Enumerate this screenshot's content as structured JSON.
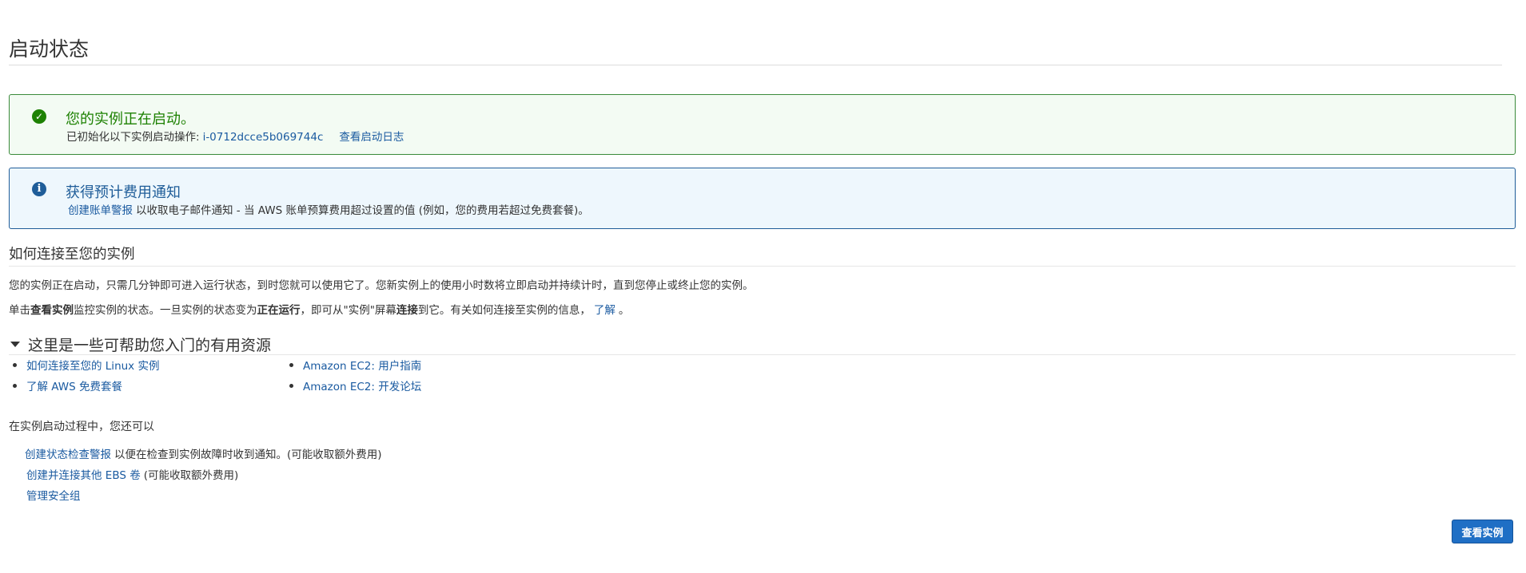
{
  "page": {
    "title": "启动状态"
  },
  "success_alert": {
    "title": "您的实例正在启动。",
    "body_prefix": "已初始化以下实例启动操作:",
    "instance_id": "i-0712dcce5b069744c",
    "view_log_link": "查看启动日志",
    "icon": "check-circle-icon",
    "color": "#1d8102"
  },
  "info_alert": {
    "title": "获得预计费用通知",
    "link": "创建账单警报",
    "body": "以收取电子邮件通知 - 当 AWS 账单预算费用超过设置的值 (例如，您的费用若超过免费套餐)。",
    "icon": "info-circle-icon",
    "color": "#1f5d99"
  },
  "connect_section": {
    "heading": "如何连接至您的实例",
    "paragraph1": "您的实例正在启动，只需几分钟即可进入运行状态，到时您就可以使用它了。您新实例上的使用小时数将立即启动并持续计时，直到您停止或终止您的实例。",
    "p2_a": "单击",
    "p2_b": "查看实例",
    "p2_c": "监控实例的状态。一旦实例的状态变为",
    "p2_d": "正在运行",
    "p2_e": "，即可从\"实例\"屏幕",
    "p2_f": "连接",
    "p2_g": "到它。有关如何连接至实例的信息，",
    "p2_link": "了解",
    "p2_end": "。"
  },
  "resources": {
    "heading": "这里是一些可帮助您入门的有用资源",
    "column1": [
      "如何连接至您的 Linux 实例",
      "了解 AWS 免费套餐"
    ],
    "column2": [
      "Amazon EC2: 用户指南",
      "Amazon EC2: 开发论坛"
    ]
  },
  "during_launch": {
    "heading": "在实例启动过程中，您还可以",
    "items": [
      {
        "link": "创建状态检查警报",
        "note": "以便在检查到实例故障时收到通知。(可能收取额外费用)"
      },
      {
        "link": "创建并连接其他 EBS 卷",
        "note": "(可能收取额外费用)"
      },
      {
        "link": "管理安全组",
        "note": ""
      }
    ]
  },
  "view_instances_button": "查看实例"
}
